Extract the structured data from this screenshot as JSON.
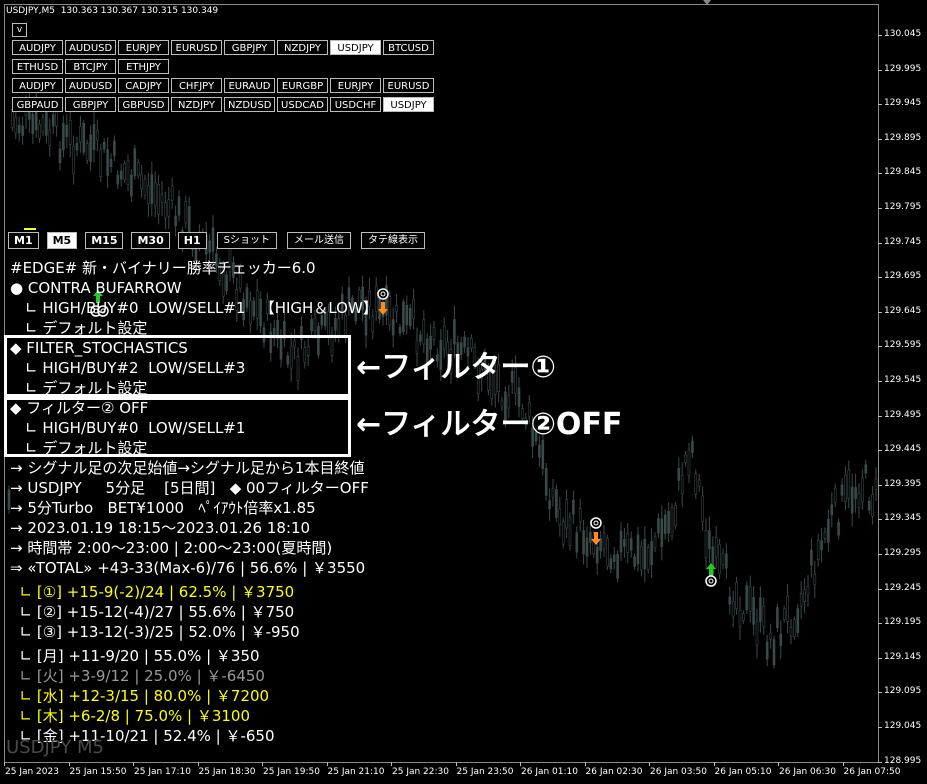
{
  "header": {
    "symbol_tf": "USDJPY,M5",
    "ohlc": "130.363 130.367 130.315 130.349",
    "v_label": "v"
  },
  "symbol_rows": [
    [
      "AUDJPY",
      "AUDUSD",
      "EURJPY",
      "EURUSD",
      "GBPJPY",
      "NZDJPY",
      "USDJPY",
      "BTCUSD"
    ],
    [
      "ETHUSD",
      "BTCJPY",
      "ETHJPY"
    ],
    [
      "AUDJPY",
      "AUDUSD",
      "CADJPY",
      "CHFJPY",
      "EURAUD",
      "EURGBP",
      "EURJPY",
      "EURUSD"
    ],
    [
      "GBPAUD",
      "GBPJPY",
      "GBPUSD",
      "NZDJPY",
      "NZDUSD",
      "USDCAD",
      "USDCHF",
      "USDJPY"
    ]
  ],
  "timeframes": [
    "M1",
    "M5",
    "M15",
    "M30",
    "H1"
  ],
  "active_timeframe": "M5",
  "tools": [
    "Sショット",
    "メール送信",
    "タテ線表示"
  ],
  "indicator": {
    "title": "#EDGE# 新・バイナリー勝率チェッカー6.0",
    "lines": [
      "● CONTRA BUFARROW",
      "　∟ HIGH/BUY#0  LOW/SELL#1   【HIGH＆LOW】",
      "　∟ デフォルト設定",
      "◆ FILTER_STOCHASTICS",
      "　∟ HIGH/BUY#2  LOW/SELL#3",
      "　∟ デフォルト設定",
      "◆ フィルター② OFF",
      "　∟ HIGH/BUY#0  LOW/SELL#1",
      "　∟ デフォルト設定",
      "→ シグナル足の次足始値→シグナル足から1本目終値",
      "→ USDJPY     5分足    [5日間]   ◆ 00フィルターOFF",
      "→ 5分Turbo   BET¥1000   ﾍﾟｲｱｳﾄ倍率x1.85",
      "→ 2023.01.19 18:15～2023.01.26 18:10",
      "→ 時間帯 2:00～23:00 | 2:00～23:00(夏時間)",
      "⇒ «TOTAL» +43-33(Max-6)/76 | 56.6% | ￥3550"
    ],
    "filter_results": [
      "∟ [①] +15-9(-2)/24 | 62.5% | ￥3750",
      "∟ [②] +15-12(-4)/27 | 55.6% | ￥750",
      "∟ [③] +13-12(-3)/25 | 52.0% | ￥-950"
    ],
    "day_results": [
      "∟ [月] +11-9/20 | 55.0% | ￥350",
      "∟ [火] +3-9/12 | 25.0% | ￥-6450",
      "∟ [水] +12-3/15 | 80.0% | ￥7200",
      "∟ [木] +6-2/8 | 75.0% | ￥3100",
      "∟ [金] +11-10/21 | 52.4% | ￥-650"
    ]
  },
  "callouts": {
    "filter1": "←フィルター①",
    "filter2": "←フィルター②OFF"
  },
  "watermark": "USDJPY M5",
  "price_axis": [
    "130.045",
    "129.995",
    "129.945",
    "129.895",
    "129.845",
    "129.795",
    "129.745",
    "129.695",
    "129.645",
    "129.595",
    "129.545",
    "129.495",
    "129.445",
    "129.395",
    "129.345",
    "129.295",
    "129.245",
    "129.195",
    "129.145",
    "129.095",
    "129.045",
    "128.995"
  ],
  "time_axis": [
    "25 Jan 2023",
    "25 Jan 15:50",
    "25 Jan 17:10",
    "25 Jan 18:30",
    "25 Jan 19:50",
    "25 Jan 21:10",
    "25 Jan 22:30",
    "25 Jan 23:50",
    "26 Jan 01:10",
    "26 Jan 02:30",
    "26 Jan 03:50",
    "26 Jan 05:10",
    "26 Jan 06:30",
    "26 Jan 07:50"
  ],
  "colors": {
    "buy_arrow": "#22cc22",
    "sell_arrow": "#ff8c1a",
    "candle": "#3a4a4a",
    "highlight": "#ffff00",
    "muted": "#9a9a9a"
  }
}
